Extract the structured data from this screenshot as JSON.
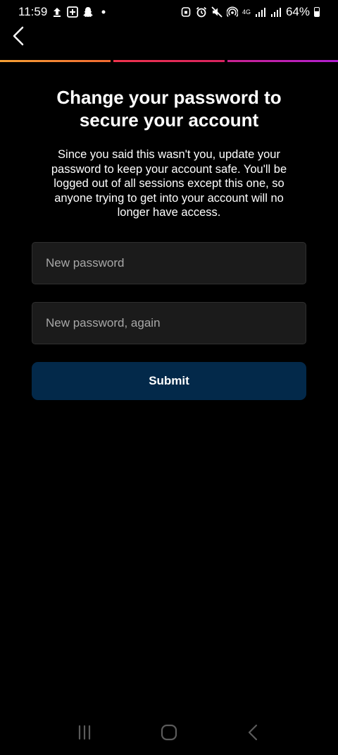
{
  "status_bar": {
    "time": "11:59",
    "network_label": "4G",
    "battery_percent": "64%",
    "icons": [
      "upload-icon",
      "news-icon",
      "snapchat-icon",
      "dot-icon",
      "lock-icon",
      "alarm-icon",
      "mute-icon",
      "hotspot-icon",
      "signal-icon",
      "signal-icon",
      "battery-icon"
    ]
  },
  "header": {
    "back_icon": "chevron-left-icon",
    "progress_colors": [
      "#f6a135",
      "#f0344d",
      "#b21fd1"
    ]
  },
  "main": {
    "title": "Change your password to secure your account",
    "description": "Since you said this wasn't you, update your password to keep your account safe. You'll be logged out of all sessions except this one, so anyone trying to get into your account will no longer have access.",
    "new_password_placeholder": "New password",
    "new_password_value": "",
    "confirm_password_placeholder": "New password, again",
    "confirm_password_value": "",
    "submit_label": "Submit",
    "submit_color": "#03294a"
  },
  "nav_bar": {
    "icons": [
      "recent-apps-icon",
      "home-icon",
      "back-icon"
    ]
  }
}
